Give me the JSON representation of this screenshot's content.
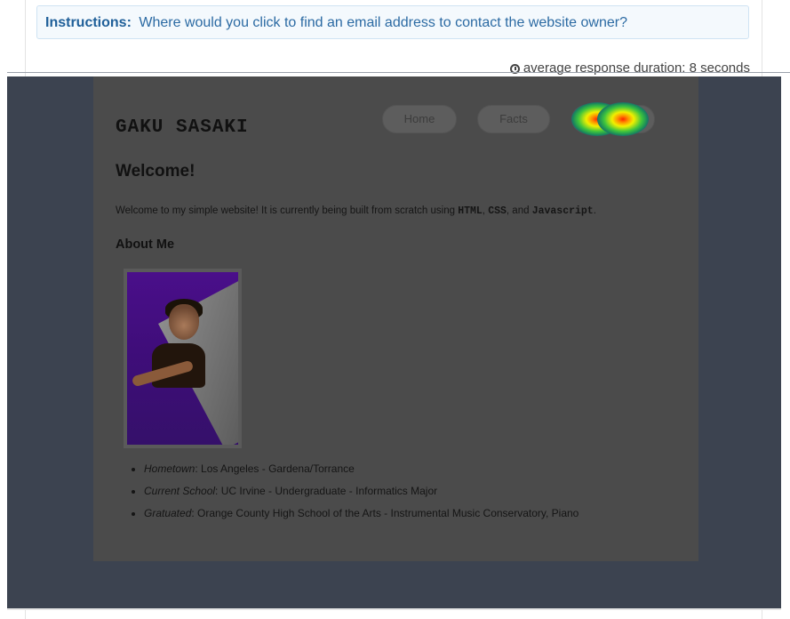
{
  "instructions": {
    "label": "Instructions:",
    "text": "Where would you click to find an email address to contact the website owner?"
  },
  "duration": {
    "icon": "clock-icon",
    "text": "average response duration: 8 seconds"
  },
  "site": {
    "title": "GAKU SASAKI",
    "nav": [
      {
        "label": "Home"
      },
      {
        "label": "Facts"
      },
      {
        "label": ""
      }
    ],
    "welcome_heading": "Welcome!",
    "intro": {
      "text_before": "Welcome to my simple website! It is currently being built from scratch using ",
      "code1": "HTML",
      "sep1": ", ",
      "code2": "CSS",
      "sep2": ", and ",
      "code3": "Javascript",
      "text_after": "."
    },
    "about_heading": "About Me",
    "facts": [
      {
        "key": "Hometown",
        "value": ": Los Angeles - Gardena/Torrance"
      },
      {
        "key": "Current School",
        "value": ": UC Irvine - Undergraduate - Informatics Major"
      },
      {
        "key": "Gratuated",
        "value": ": Orange County High School of the Arts - Instrumental Music Conservatory, Piano"
      }
    ]
  },
  "colors": {
    "overlay": "#3c4350",
    "site_panel": "#4b4b4b",
    "instruction_text": "#2b6aa3",
    "heat_hot": "#ff2400",
    "heat_mid": "#f0f000",
    "heat_cool": "#3ec43e"
  }
}
